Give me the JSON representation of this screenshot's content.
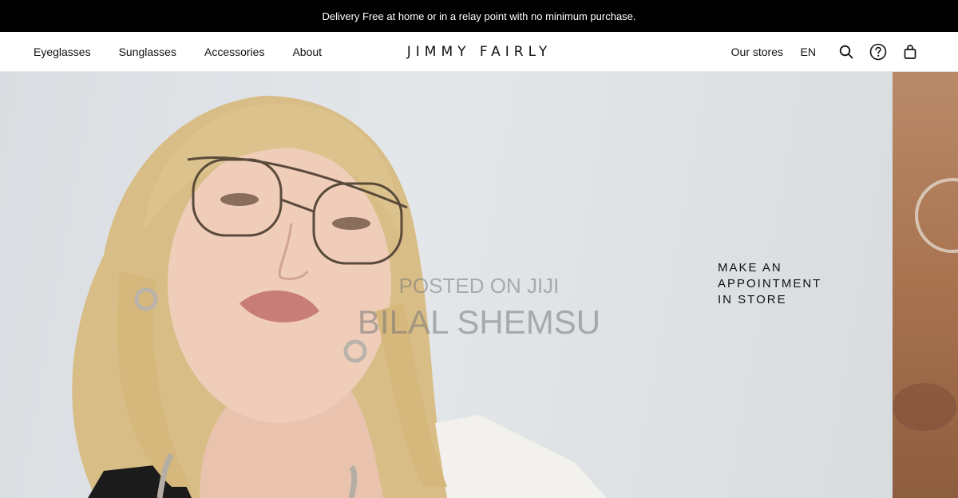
{
  "announcement": {
    "text": "Delivery Free at home or in a relay point with no minimum purchase."
  },
  "nav": {
    "left_links": [
      "Eyeglasses",
      "Sunglasses",
      "Accessories",
      "About"
    ],
    "logo": "JIMMY FAIRLY",
    "stores_label": "Our stores",
    "language": "EN",
    "icons": [
      "search-icon",
      "help-icon",
      "bag-icon"
    ]
  },
  "hero": {
    "cta_lines": [
      "MAKE AN",
      "APPOINTMENT",
      "IN STORE"
    ],
    "watermark": {
      "line1": "POSTED ON JIJI",
      "line2": "BILAL SHEMSU"
    }
  },
  "colors": {
    "topbar_bg": "#000000",
    "hero_bg": "#dfe3e7",
    "text": "#111111"
  }
}
